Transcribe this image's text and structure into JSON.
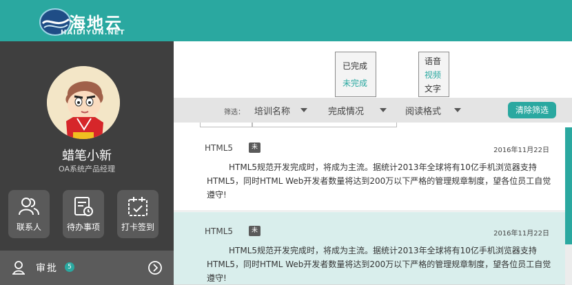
{
  "header": {
    "logo_text": "海地云",
    "logo_sub": "HAIDIYUN.NET"
  },
  "sidebar": {
    "user_name": "蜡笔小新",
    "user_title": "OA系统产品经理",
    "quick_actions": [
      {
        "label": "联系人",
        "icon": "contacts-icon"
      },
      {
        "label": "待办事项",
        "icon": "todo-icon"
      },
      {
        "label": "打卡签到",
        "icon": "checkin-icon"
      }
    ],
    "approve": {
      "label": "审批",
      "badge": "5"
    }
  },
  "popups": {
    "status_options": [
      "已完成",
      "未完成"
    ],
    "format_options": [
      "语音",
      "视频",
      "文字"
    ]
  },
  "filter": {
    "label": "筛选：",
    "options": [
      "培训名称",
      "完成情况",
      "阅读格式"
    ],
    "clear_label": "清除筛选"
  },
  "cards": [
    {
      "tag": "HTML5",
      "mark": "未",
      "date": "2016年11月22日",
      "body": "HTML5规范开发完成时，将成为主流。据统计2013年全球将有10亿手机浏览器支持HTML5，同时HTML Web开发者数量将达到200万以下严格的管理规章制度，望各位员工自觉遵守!"
    },
    {
      "tag": "HTML5",
      "mark": "未",
      "date": "2016年11月22日",
      "body": "HTML5规范开发完成时，将成为主流。据统计2013年全球将有10亿手机浏览器支持HTML5，同时HTML Web开发者数量将达到200万以下严格的管理规章制度，望各位员工自觉遵守!"
    }
  ],
  "colors": {
    "accent": "#2aa8a0",
    "sidebar": "#3f3f3f",
    "highlight_row": "#d9eeec"
  }
}
